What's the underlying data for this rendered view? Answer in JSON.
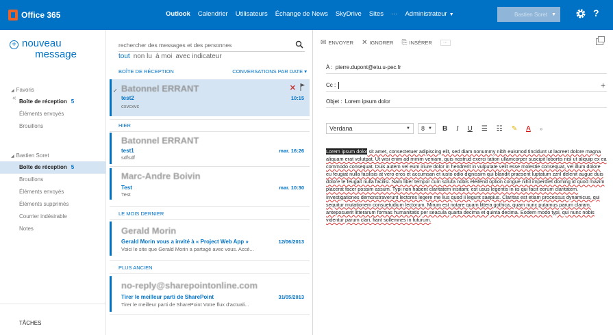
{
  "app": {
    "brand": "Office 365"
  },
  "topnav": {
    "items": [
      "Outlook",
      "Calendrier",
      "Utilisateurs",
      "Échange de News",
      "SkyDrive",
      "Sites",
      "···",
      "Administrateur"
    ],
    "active": "Outlook",
    "user_name": "Bastien Soret"
  },
  "leftnav": {
    "new_message_line1": "nouveau",
    "new_message_line2": "message",
    "collapse": "«",
    "favorites": {
      "header": "Favoris",
      "items": [
        {
          "label": "Boîte de réception",
          "count": "5"
        },
        {
          "label": "Éléments envoyés"
        },
        {
          "label": "Brouillons"
        }
      ]
    },
    "account": {
      "header": "Bastien Soret",
      "items": [
        {
          "label": "Boîte de réception",
          "count": "5"
        },
        {
          "label": "Brouillons"
        },
        {
          "label": "Éléments envoyés"
        },
        {
          "label": "Éléments supprimés"
        },
        {
          "label": "Courrier indésirable"
        },
        {
          "label": "Notes"
        }
      ]
    },
    "tasks": "TÂCHES"
  },
  "msglist": {
    "search_placeholder": "rechercher des messages et des personnes",
    "filters": [
      "tout",
      "non lu",
      "à moi",
      "avec indicateur"
    ],
    "inbox_label": "BOÎTE DE RÉCEPTION",
    "sort_label": "CONVERSATIONS PAR DATE",
    "groups": [
      "HIER",
      "LE MOIS DERNIER",
      "PLUS ANCIEN"
    ],
    "messages": [
      {
        "from": "Batonnel ERRANT",
        "subject": "test2",
        "preview": "cxvcxvc",
        "date": "10:15"
      },
      {
        "from": "Batonnel ERRANT",
        "subject": "test1",
        "preview": "sdfsdf",
        "date": "mar. 16:26"
      },
      {
        "from": "Marc-Andre Boivin",
        "subject": "Test",
        "preview": "Test",
        "date": "mar. 10:30"
      },
      {
        "from": "Gerald Morin",
        "subject": "Gerald Morin vous a invité à « Project Web App »",
        "preview": "Voici le site que Gerald Morin a partagé avec vous. Accé...",
        "date": "12/06/2013"
      },
      {
        "from": "no-reply@sharepointonline.com",
        "subject": "Tirer le meilleur parti de SharePoint",
        "preview": "Tirer le meilleur parti de SharePoint    Votre flux d'actuali...",
        "date": "31/05/2013"
      }
    ]
  },
  "compose": {
    "toolbar": {
      "send": "ENVOYER",
      "discard": "IGNORER",
      "insert": "INSÉRER",
      "more": "···"
    },
    "to_label": "À :",
    "to_value": "pierre.dupont@etu.u-pec.fr",
    "cc_label": "Cc :",
    "subject_label": "Objet :",
    "subject_value": "Lorem ipsum dolor",
    "font_name": "Verdana",
    "font_size": "8",
    "fmt": {
      "bold": "B",
      "italic": "I",
      "underline": "U",
      "color": "A"
    },
    "body_selected": "Lorem ipsum dolor",
    "body_rest": " sit amet, consectetuer adipiscing elit, sed diam nonummy nibh euismod tincidunt ut laoreet dolore magna aliquam erat volutpat. Ut wisi enim ad minim veniam, quis nostrud exerci tation ullamcorper suscipit lobortis nisl ut aliquip ex ea commodo consequat. Duis autem vel eum iriure dolor in hendrerit in vulputate velit esse molestie consequat, vel illum dolore eu feugiat nulla facilisis at vero eros et accumsan et iusto odio dignissim qui blandit praesent luptatum zzril delenit augue duis dolore te feugait nulla facilisi. Nam liber tempor cum soluta nobis eleifend option congue nihil imperdiet doming id quod mazim placerat facer possim assum. Typi non habent claritatem insitam; est usus legentis in iis qui facit eorum claritatem. Investigationes demonstraverunt lectores legere me lius quod ii legunt saepius. Claritas est etiam processus dynamicus, qui sequitur mutationem consuetudium lectorum. Mirum est notare quam littera gothica, quam nunc putamus parum claram, anteposuerit litterarum formas humanitatis per seacula quarta decima et quinta decima. Eodem modo typi, qui nunc nobis videntur parum clari, fiant sollemnes in futurum."
  }
}
